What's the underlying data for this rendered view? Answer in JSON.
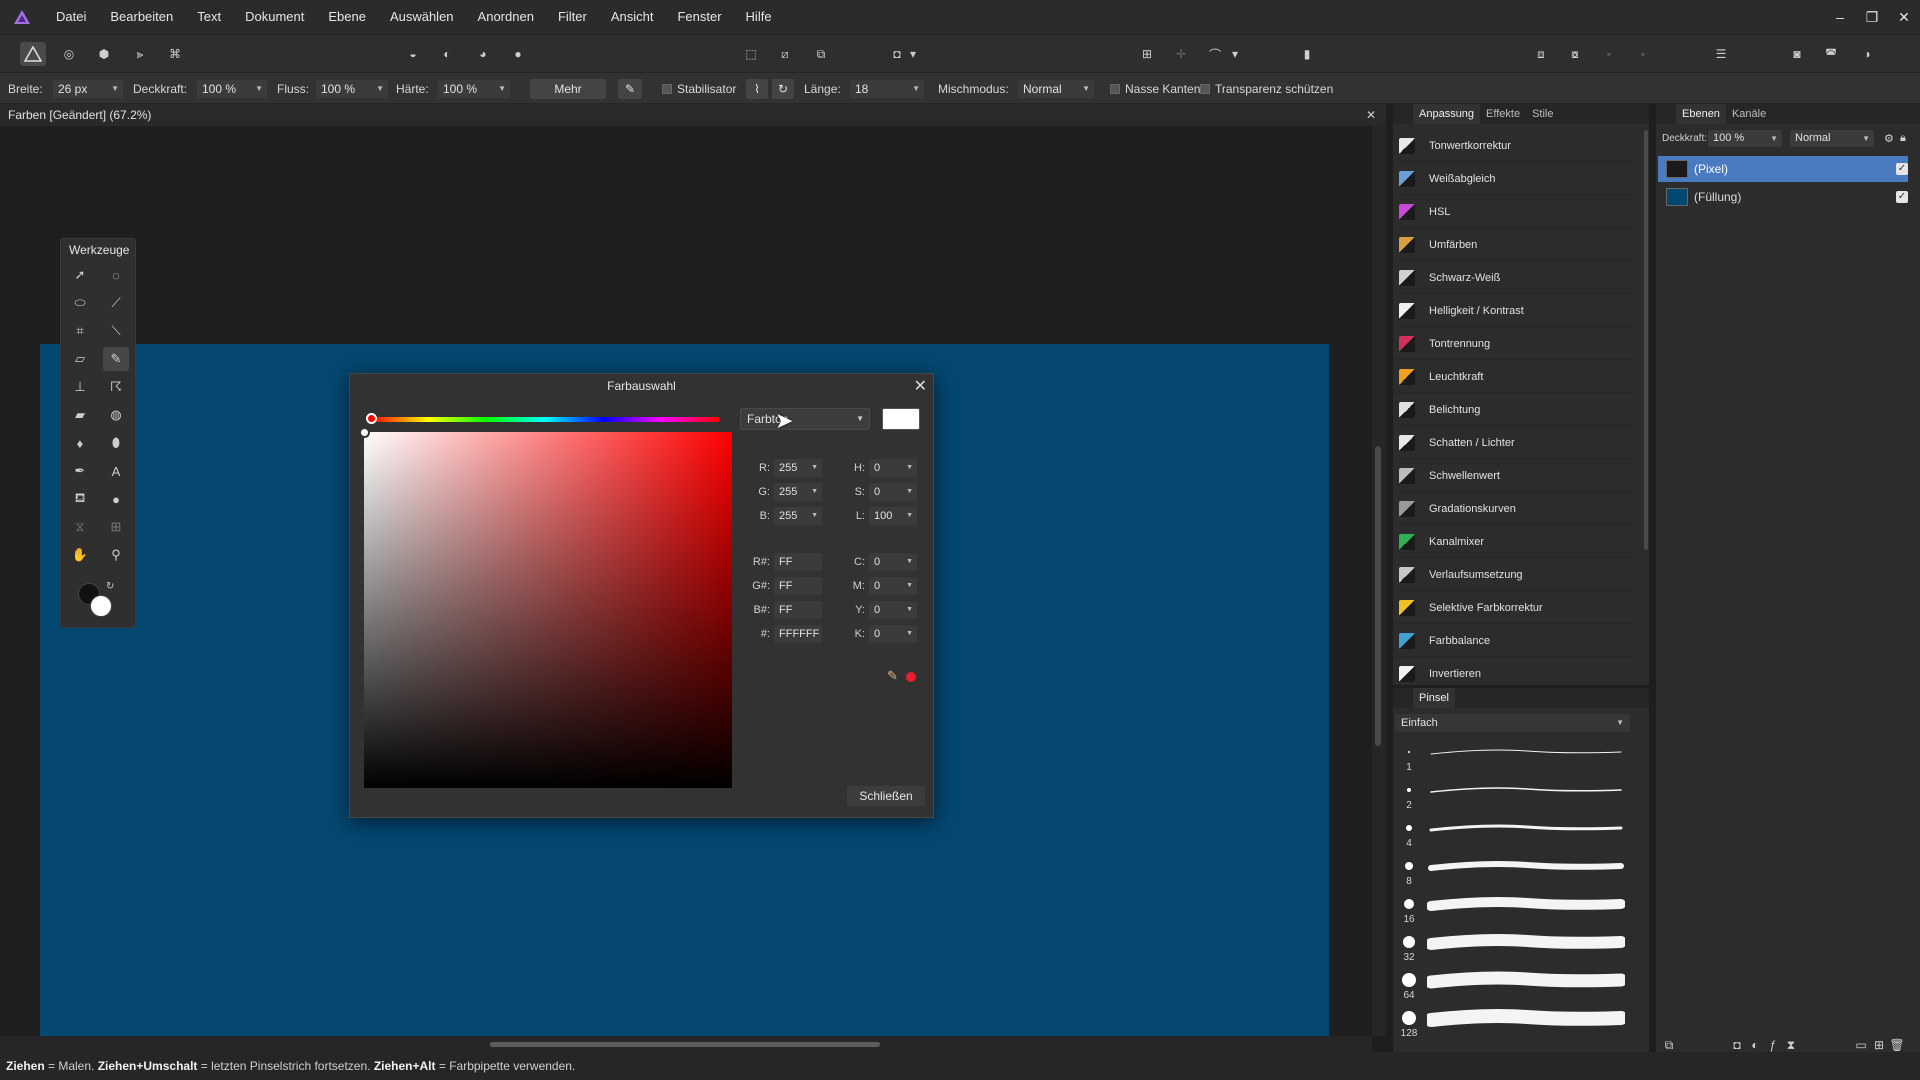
{
  "menu": {
    "items": [
      "Datei",
      "Bearbeiten",
      "Text",
      "Dokument",
      "Ebene",
      "Auswählen",
      "Anordnen",
      "Filter",
      "Ansicht",
      "Fenster",
      "Hilfe"
    ]
  },
  "window": {
    "minimize": "–",
    "restore": "❐",
    "close": "✕"
  },
  "context_bar": {
    "width_label": "Breite:",
    "width_value": "26 px",
    "opacity_label": "Deckkraft:",
    "opacity_value": "100 %",
    "flow_label": "Fluss:",
    "flow_value": "100 %",
    "hardness_label": "Härte:",
    "hardness_value": "100 %",
    "more_label": "Mehr",
    "stabilizer_label": "Stabilisator",
    "length_label": "Länge:",
    "length_value": "18",
    "blend_label": "Mischmodus:",
    "blend_value": "Normal",
    "wet_edges_label": "Nasse Kanten",
    "protect_alpha_label": "Transparenz schützen"
  },
  "document": {
    "tab_title": "Farben [Geändert] (67.2%)",
    "close": "✕"
  },
  "tools": {
    "title": "Werkzeuge"
  },
  "dialog": {
    "title": "Farbauswahl",
    "model_value": "Farbton",
    "r_label": "R:",
    "r_value": "255",
    "g_label": "G:",
    "g_value": "255",
    "b_label": "B:",
    "b_value": "255",
    "h_label": "H:",
    "h_value": "0",
    "s_label": "S:",
    "s_value": "0",
    "l_label": "L:",
    "l_value": "100",
    "rh_label": "R#:",
    "rh_value": "FF",
    "gh_label": "G#:",
    "gh_value": "FF",
    "bh_label": "B#:",
    "bh_value": "FF",
    "hex_label": "#:",
    "hex_value": "FFFFFF",
    "c_label": "C:",
    "c_value": "0",
    "m_label": "M:",
    "m_value": "0",
    "y_label": "Y:",
    "y_value": "0",
    "k_label": "K:",
    "k_value": "0",
    "close_button": "Schließen"
  },
  "adjustments": {
    "tabs": [
      "Anpassung",
      "Effekte",
      "Stile"
    ],
    "items": [
      {
        "label": "Tonwertkorrektur",
        "color": "#e8e8e8"
      },
      {
        "label": "Weißabgleich",
        "color": "#6aa0d8"
      },
      {
        "label": "HSL",
        "color": "#c84bd6"
      },
      {
        "label": "Umfärben",
        "color": "#d8a040"
      },
      {
        "label": "Schwarz-Weiß",
        "color": "#d0d0d0"
      },
      {
        "label": "Helligkeit / Kontrast",
        "color": "#f0f0f0"
      },
      {
        "label": "Tontrennung",
        "color": "#d0305a"
      },
      {
        "label": "Leuchtkraft",
        "color": "#f0a020"
      },
      {
        "label": "Belichtung",
        "color": "#e0e0e0"
      },
      {
        "label": "Schatten / Lichter",
        "color": "#e8e8e8"
      },
      {
        "label": "Schwellenwert",
        "color": "#bcbcbc"
      },
      {
        "label": "Gradationskurven",
        "color": "#9a9a9a"
      },
      {
        "label": "Kanalmixer",
        "color": "#30b050"
      },
      {
        "label": "Verlaufsumsetzung",
        "color": "#c8c8c8"
      },
      {
        "label": "Selektive Farbkorrektur",
        "color": "#f0c020"
      },
      {
        "label": "Farbbalance",
        "color": "#40a0d0"
      },
      {
        "label": "Invertieren",
        "color": "#f0f0f0"
      }
    ]
  },
  "brushes": {
    "tab": "Pinsel",
    "category": "Einfach",
    "sizes": [
      "1",
      "2",
      "4",
      "8",
      "16",
      "32",
      "64",
      "128"
    ]
  },
  "layers": {
    "tabs": [
      "Ebenen",
      "Kanäle"
    ],
    "opacity_label": "Deckkraft:",
    "opacity_value": "100 %",
    "blend_value": "Normal",
    "items": [
      {
        "name": "(Pixel)",
        "thumb": "#1a1a1a"
      },
      {
        "name": "(Füllung)",
        "thumb": "#044770"
      }
    ]
  },
  "status": {
    "k1": "Ziehen",
    "t1": " = Malen. ",
    "k2": "Ziehen+Umschalt",
    "t2": " = letzten Pinselstrich fortsetzen. ",
    "k3": "Ziehen+Alt",
    "t3": " = Farbpipette verwenden."
  },
  "colors": {
    "artboard": "#044770",
    "selection": "#4a7bc0",
    "accent": "#e81e2e"
  }
}
